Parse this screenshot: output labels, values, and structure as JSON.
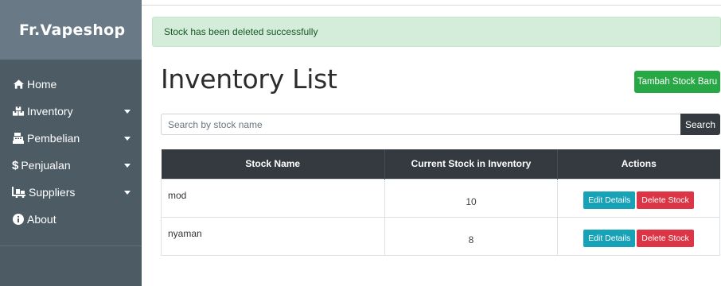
{
  "app": {
    "brand": "Fr.Vapeshop"
  },
  "sidebar": {
    "items": [
      {
        "label": "Home",
        "icon": "home-icon",
        "dropdown": false
      },
      {
        "label": "Inventory",
        "icon": "boxes-icon",
        "dropdown": true
      },
      {
        "label": "Pembelian",
        "icon": "cash-register-icon",
        "dropdown": true
      },
      {
        "label": "Penjualan",
        "icon": "dollar-icon",
        "dropdown": true
      },
      {
        "label": "Suppliers",
        "icon": "truck-loading-icon",
        "dropdown": true
      },
      {
        "label": "About",
        "icon": "info-circle-icon",
        "dropdown": false
      }
    ]
  },
  "alert": {
    "message": "Stock has been deleted successfully",
    "color": "#d4edda"
  },
  "page": {
    "title": "Inventory List",
    "add_button": "Tambah Stock Baru"
  },
  "search": {
    "placeholder": "Search by stock name",
    "value": "",
    "button": "Search"
  },
  "table": {
    "headers": [
      "Stock Name",
      "Current Stock in Inventory",
      "Actions"
    ],
    "rows": [
      {
        "name": "mod",
        "qty": "10",
        "edit": "Edit Details",
        "delete": "Delete Stock"
      },
      {
        "name": "nyaman",
        "qty": "8",
        "edit": "Edit Details",
        "delete": "Delete Stock"
      }
    ]
  },
  "colors": {
    "sidebar": "#4d5b64",
    "brand_bar": "#697a86",
    "success": "#28a745",
    "dark": "#343a40",
    "info": "#17a2b8",
    "danger": "#dc3545"
  }
}
